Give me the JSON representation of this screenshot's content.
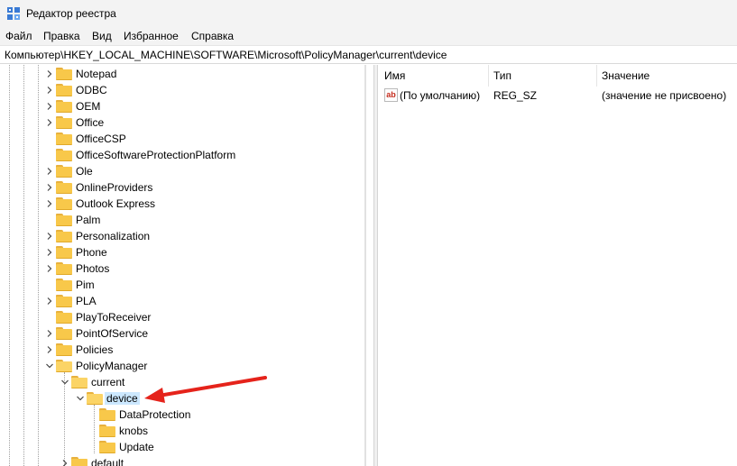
{
  "window": {
    "title": "Редактор реестра"
  },
  "menu": [
    {
      "id": "file",
      "label": "Файл"
    },
    {
      "id": "edit",
      "label": "Правка"
    },
    {
      "id": "view",
      "label": "Вид"
    },
    {
      "id": "favorites",
      "label": "Избранное"
    },
    {
      "id": "help",
      "label": "Справка"
    }
  ],
  "address": {
    "path": "Компьютер\\HKEY_LOCAL_MACHINE\\SOFTWARE\\Microsoft\\PolicyManager\\current\\device"
  },
  "tree": [
    {
      "label": "Notepad",
      "depth": 0,
      "expander": "collapsed"
    },
    {
      "label": "ODBC",
      "depth": 0,
      "expander": "collapsed"
    },
    {
      "label": "OEM",
      "depth": 0,
      "expander": "collapsed"
    },
    {
      "label": "Office",
      "depth": 0,
      "expander": "collapsed"
    },
    {
      "label": "OfficeCSP",
      "depth": 0,
      "expander": "none"
    },
    {
      "label": "OfficeSoftwareProtectionPlatform",
      "depth": 0,
      "expander": "none"
    },
    {
      "label": "Ole",
      "depth": 0,
      "expander": "collapsed"
    },
    {
      "label": "OnlineProviders",
      "depth": 0,
      "expander": "collapsed"
    },
    {
      "label": "Outlook Express",
      "depth": 0,
      "expander": "collapsed"
    },
    {
      "label": "Palm",
      "depth": 0,
      "expander": "none"
    },
    {
      "label": "Personalization",
      "depth": 0,
      "expander": "collapsed"
    },
    {
      "label": "Phone",
      "depth": 0,
      "expander": "collapsed"
    },
    {
      "label": "Photos",
      "depth": 0,
      "expander": "collapsed"
    },
    {
      "label": "Pim",
      "depth": 0,
      "expander": "none"
    },
    {
      "label": "PLA",
      "depth": 0,
      "expander": "collapsed"
    },
    {
      "label": "PlayToReceiver",
      "depth": 0,
      "expander": "none"
    },
    {
      "label": "PointOfService",
      "depth": 0,
      "expander": "collapsed"
    },
    {
      "label": "Policies",
      "depth": 0,
      "expander": "collapsed"
    },
    {
      "label": "PolicyManager",
      "depth": 0,
      "expander": "expanded"
    },
    {
      "label": "current",
      "depth": 1,
      "expander": "expanded"
    },
    {
      "label": "device",
      "depth": 2,
      "expander": "expanded",
      "selected": true
    },
    {
      "label": "DataProtection",
      "depth": 3,
      "expander": "none"
    },
    {
      "label": "knobs",
      "depth": 3,
      "expander": "none"
    },
    {
      "label": "Update",
      "depth": 3,
      "expander": "none"
    },
    {
      "label": "default",
      "depth": 1,
      "expander": "collapsed"
    }
  ],
  "list": {
    "columns": [
      "Имя",
      "Тип",
      "Значение"
    ],
    "rows": [
      {
        "icon": "string-value-icon",
        "icon_text": "ab",
        "name": "(По умолчанию)",
        "type": "REG_SZ",
        "value": "(значение не присвоено)"
      }
    ]
  },
  "colors": {
    "selection": "#cce8ff",
    "folder": "#f8c84a",
    "annotation_arrow": "#e5231b"
  }
}
